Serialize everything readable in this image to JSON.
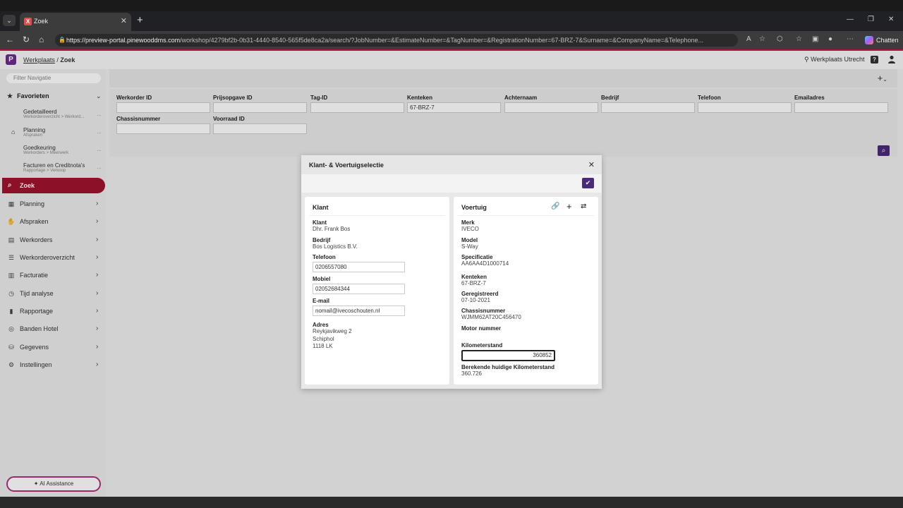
{
  "browser": {
    "tab_title": "Zoek",
    "tab_favicon": "X",
    "url_host": "https://preview-portal.pinewooddms.com",
    "url_path": "/workshop/4279bf2b-0b31-4440-8540-565f5de8ca2a/search/?JobNumber=&EstimateNumber=&TagNumber=&RegistrationNumber=67-BRZ-7&Surname=&CompanyName=&Telephone...",
    "chat_label": "Chatten"
  },
  "header": {
    "logo": "P",
    "breadcrumb_root": "Werkplaats",
    "breadcrumb_sep": "/",
    "breadcrumb_current": "Zoek",
    "location": "Werkplaats Utrecht",
    "help": "?"
  },
  "sidebar": {
    "filter_placeholder": "Filter Navigatie",
    "favorites_label": "Favorieten",
    "favorites": [
      {
        "title": "Gedetailleerd",
        "sub": "Werkorderoverzicht > Werkord..."
      },
      {
        "title": "Planning",
        "sub": "Afspraken"
      },
      {
        "title": "Goedkeuring",
        "sub": "Werkorders > Meerwerk"
      },
      {
        "title": "Facturen en Creditnota's",
        "sub": "Rapportage > Verkoop"
      }
    ],
    "active": "Zoek",
    "items": [
      {
        "label": "Planning",
        "icon": "calendar-icon"
      },
      {
        "label": "Afspraken",
        "icon": "handshake-icon"
      },
      {
        "label": "Werkorders",
        "icon": "briefcase-icon"
      },
      {
        "label": "Werkorderoverzicht",
        "icon": "list-icon"
      },
      {
        "label": "Facturatie",
        "icon": "invoice-icon"
      },
      {
        "label": "Tijd analyse",
        "icon": "clock-icon"
      },
      {
        "label": "Rapportage",
        "icon": "bar-chart-icon"
      },
      {
        "label": "Banden Hotel",
        "icon": "tire-icon"
      },
      {
        "label": "Gegevens",
        "icon": "database-icon"
      },
      {
        "label": "Instellingen",
        "icon": "gear-icon"
      }
    ],
    "ai_label": "AI Assistance"
  },
  "search": {
    "fields": [
      {
        "label": "Werkorder ID",
        "value": ""
      },
      {
        "label": "Prijsopgave ID",
        "value": ""
      },
      {
        "label": "Tag-ID",
        "value": ""
      },
      {
        "label": "Kenteken",
        "value": "67-BRZ-7"
      },
      {
        "label": "Achternaam",
        "value": ""
      },
      {
        "label": "Bedrijf",
        "value": ""
      },
      {
        "label": "Telefoon",
        "value": ""
      },
      {
        "label": "Emailadres",
        "value": ""
      },
      {
        "label": "Chassisnummer",
        "value": ""
      },
      {
        "label": "Voorraad ID",
        "value": ""
      }
    ]
  },
  "modal": {
    "title": "Klant- & Voertuigselectie",
    "customer": {
      "card_title": "Klant",
      "klant_label": "Klant",
      "klant_value": "Dhr. Frank Bos",
      "bedrijf_label": "Bedrijf",
      "bedrijf_value": "Bos Logistics B.V.",
      "telefoon_label": "Telefoon",
      "telefoon_value": "0206557080",
      "mobiel_label": "Mobiel",
      "mobiel_value": "02052684344",
      "email_label": "E-mail",
      "email_value": "nomail@ivecoschouten.nl",
      "adres_label": "Adres",
      "adres_line1": "Reykjavikweg 2",
      "adres_line2": "Schiphol",
      "adres_line3": "1118 LK"
    },
    "vehicle": {
      "card_title": "Voertuig",
      "merk_label": "Merk",
      "merk_value": "IVECO",
      "model_label": "Model",
      "model_value": "S-Way",
      "spec_label": "Specificatie",
      "spec_value": "AA6AA4D1000714",
      "kenteken_label": "Kenteken",
      "kenteken_value": "67-BRZ-7",
      "geregistreerd_label": "Geregistreerd",
      "geregistreerd_value": "07-10-2021",
      "chassis_label": "Chassisnummer",
      "chassis_value": "WJMM62AT20C456470",
      "motor_label": "Motor nummer",
      "motor_value": "",
      "km_label": "Kilometerstand",
      "km_value": "360852",
      "calc_km_label": "Berekende huidige Kilometerstand",
      "calc_km_value": "360.726"
    }
  }
}
